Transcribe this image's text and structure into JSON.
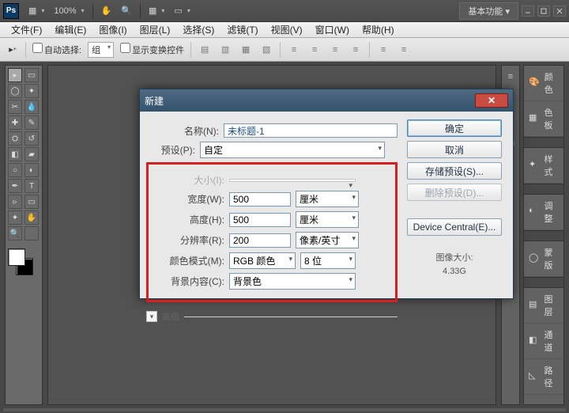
{
  "titlebar": {
    "logo": "Ps",
    "zoom": "100%",
    "workspace": "基本功能"
  },
  "menubar": {
    "items": [
      "文件(F)",
      "编辑(E)",
      "图像(I)",
      "图层(L)",
      "选择(S)",
      "滤镜(T)",
      "视图(V)",
      "窗口(W)",
      "帮助(H)"
    ]
  },
  "optionsbar": {
    "auto_select_label": "自动选择:",
    "auto_select_value": "组",
    "show_transform_label": "显示变换控件"
  },
  "panels": {
    "items": [
      "颜色",
      "色板",
      "样式",
      "调整",
      "蒙版",
      "图层",
      "通道",
      "路径"
    ]
  },
  "dialog": {
    "title": "新建",
    "name_label": "名称(N):",
    "name_value": "未标题-1",
    "preset_label": "预设(P):",
    "preset_value": "自定",
    "size_label": "大小(I):",
    "width_label": "宽度(W):",
    "width_value": "500",
    "width_unit": "厘米",
    "height_label": "高度(H):",
    "height_value": "500",
    "height_unit": "厘米",
    "res_label": "分辨率(R):",
    "res_value": "200",
    "res_unit": "像素/英寸",
    "mode_label": "颜色模式(M):",
    "mode_value": "RGB 颜色",
    "mode_depth": "8 位",
    "bg_label": "背景内容(C):",
    "bg_value": "背景色",
    "advanced": "高级",
    "buttons": {
      "ok": "确定",
      "cancel": "取消",
      "save_preset": "存储预设(S)...",
      "delete_preset": "删除预设(D)...",
      "device_central": "Device Central(E)..."
    },
    "image_size_label": "图像大小:",
    "image_size_value": "4.33G"
  }
}
